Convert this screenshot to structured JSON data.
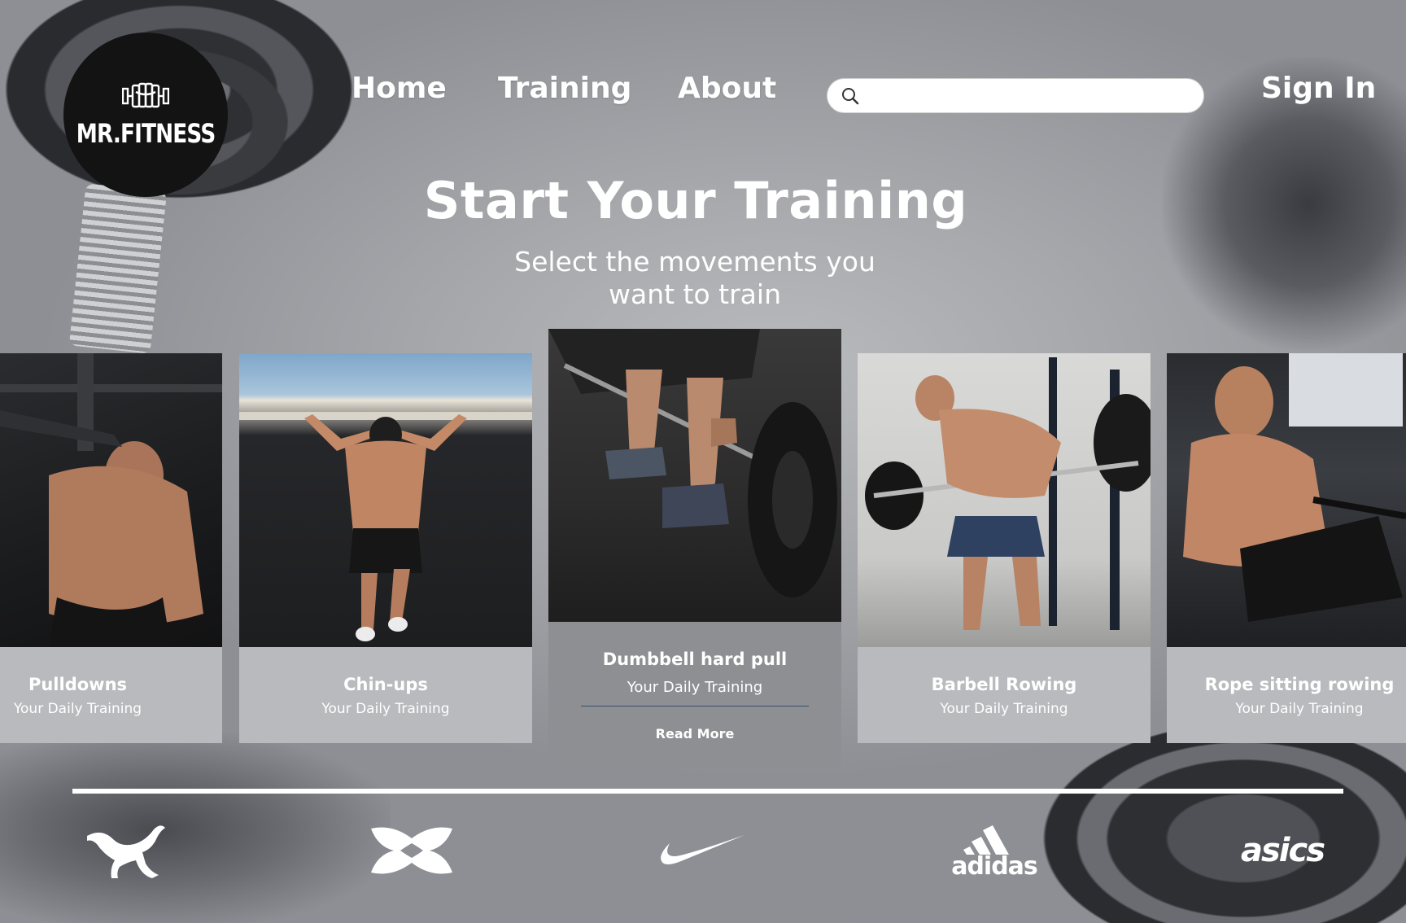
{
  "brand": {
    "logo_text": "MR.FITNESS",
    "logo_icon": "fist-icon"
  },
  "nav": {
    "items": [
      "Home",
      "Training",
      "About"
    ],
    "signin_label": "Sign In"
  },
  "search": {
    "placeholder": "",
    "value": "",
    "icon": "search-icon"
  },
  "hero": {
    "title": "Start Your Training",
    "subtitle": "Select the movements you want to train"
  },
  "cards": [
    {
      "title": "Pulldowns",
      "subtitle": "Your Daily Training",
      "featured": false
    },
    {
      "title": "Chin-ups",
      "subtitle": "Your Daily Training",
      "featured": false
    },
    {
      "title": "Dumbbell hard pull",
      "subtitle": "Your Daily Training",
      "featured": true,
      "action_label": "Read More"
    },
    {
      "title": "Barbell Rowing",
      "subtitle": "Your Daily Training",
      "featured": false
    },
    {
      "title": "Rope sitting rowing",
      "subtitle": "Your Daily Training",
      "featured": false
    }
  ],
  "partners": {
    "logos": [
      "puma-logo",
      "under-armour-logo",
      "nike-logo",
      "adidas-logo",
      "asics-logo"
    ],
    "adidas_wordmark": "adidas",
    "asics_wordmark": "asics"
  },
  "colors": {
    "background": "#a7a8ac",
    "logo_circle": "#131314",
    "card_info": "#b9babd",
    "card_info_featured": "#8e8f92",
    "divider": "#34506b",
    "text": "#ffffff"
  }
}
